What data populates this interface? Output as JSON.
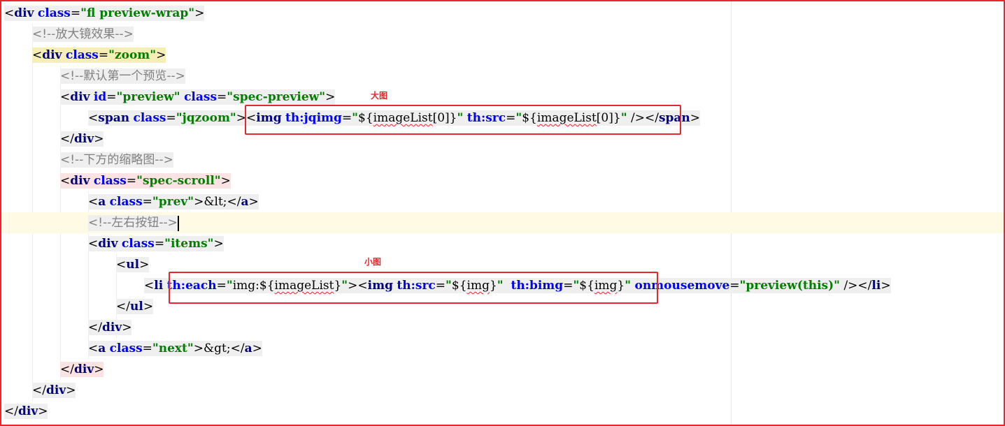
{
  "editor": {
    "lines": [
      {
        "indent": 0,
        "tokens": [
          [
            "angle",
            "<"
          ],
          [
            "tag",
            "div"
          ],
          [
            "sp",
            " "
          ],
          [
            "attr",
            "class"
          ],
          [
            "punct",
            "="
          ],
          [
            "val",
            "\"fl preview-wrap\""
          ],
          [
            "angle",
            ">"
          ]
        ]
      },
      {
        "indent": 1,
        "tokens": [
          [
            "comment",
            "<!--放大镜效果-->"
          ]
        ]
      },
      {
        "indent": 1,
        "tokens": [
          [
            "angle",
            "<"
          ],
          [
            "tag",
            "div"
          ],
          [
            "sp",
            " "
          ],
          [
            "attr",
            "class"
          ],
          [
            "punct",
            "="
          ],
          [
            "val",
            "\"zoom\""
          ],
          [
            "angle",
            ">"
          ]
        ]
      },
      {
        "indent": 2,
        "tokens": [
          [
            "comment",
            "<!--默认第一个预览-->"
          ]
        ]
      },
      {
        "indent": 2,
        "tokens": [
          [
            "angle",
            "<"
          ],
          [
            "tag",
            "div"
          ],
          [
            "sp",
            " "
          ],
          [
            "attr",
            "id"
          ],
          [
            "punct",
            "="
          ],
          [
            "val",
            "\"preview\""
          ],
          [
            "sp",
            " "
          ],
          [
            "attr",
            "class"
          ],
          [
            "punct",
            "="
          ],
          [
            "val",
            "\"spec-preview\""
          ],
          [
            "angle",
            ">"
          ]
        ]
      },
      {
        "indent": 3,
        "tokens": [
          [
            "angle",
            "<"
          ],
          [
            "tag",
            "span"
          ],
          [
            "sp",
            " "
          ],
          [
            "attr",
            "class"
          ],
          [
            "punct",
            "="
          ],
          [
            "val",
            "\"jqzoom\""
          ],
          [
            "angle",
            ">"
          ],
          [
            "angle",
            "<"
          ],
          [
            "tag",
            "img"
          ],
          [
            "sp",
            " "
          ],
          [
            "attr",
            "th:jqimg"
          ],
          [
            "punct",
            "="
          ],
          [
            "val",
            "\""
          ],
          [
            "expr",
            "${"
          ],
          [
            "squig",
            "imageList"
          ],
          [
            "expr",
            "[0]}"
          ],
          [
            "val",
            "\""
          ],
          [
            "sp",
            " "
          ],
          [
            "attr",
            "th:src"
          ],
          [
            "punct",
            "="
          ],
          [
            "val",
            "\""
          ],
          [
            "expr",
            "${"
          ],
          [
            "squig",
            "imageList"
          ],
          [
            "expr",
            "[0]}"
          ],
          [
            "val",
            "\""
          ],
          [
            "sp",
            " "
          ],
          [
            "angle",
            "/>"
          ],
          [
            "angle",
            "</"
          ],
          [
            "tag",
            "span"
          ],
          [
            "angle",
            ">"
          ]
        ]
      },
      {
        "indent": 2,
        "tokens": [
          [
            "angle",
            "</"
          ],
          [
            "tag",
            "div"
          ],
          [
            "angle",
            ">"
          ]
        ]
      },
      {
        "indent": 2,
        "tokens": [
          [
            "comment",
            "<!--下方的缩略图-->"
          ]
        ]
      },
      {
        "indent": 2,
        "tokens": [
          [
            "angle",
            "<"
          ],
          [
            "tag",
            "div"
          ],
          [
            "sp",
            " "
          ],
          [
            "attr",
            "class"
          ],
          [
            "punct",
            "="
          ],
          [
            "val",
            "\"spec-scroll\""
          ],
          [
            "angle",
            ">"
          ]
        ]
      },
      {
        "indent": 3,
        "tokens": [
          [
            "angle",
            "<"
          ],
          [
            "tag",
            "a"
          ],
          [
            "sp",
            " "
          ],
          [
            "attr",
            "class"
          ],
          [
            "punct",
            "="
          ],
          [
            "val",
            "\"prev\""
          ],
          [
            "angle",
            ">"
          ],
          [
            "entity",
            "&lt;"
          ],
          [
            "angle",
            "</"
          ],
          [
            "tag",
            "a"
          ],
          [
            "angle",
            ">"
          ]
        ]
      },
      {
        "indent": 3,
        "tokens": [
          [
            "comment",
            "<!--左右按钮-->"
          ]
        ]
      },
      {
        "indent": 3,
        "tokens": [
          [
            "angle",
            "<"
          ],
          [
            "tag",
            "div"
          ],
          [
            "sp",
            " "
          ],
          [
            "attr",
            "class"
          ],
          [
            "punct",
            "="
          ],
          [
            "val",
            "\"items\""
          ],
          [
            "angle",
            ">"
          ]
        ]
      },
      {
        "indent": 4,
        "tokens": [
          [
            "angle",
            "<"
          ],
          [
            "tag",
            "ul"
          ],
          [
            "angle",
            ">"
          ]
        ]
      },
      {
        "indent": 5,
        "tokens": [
          [
            "angle",
            "<"
          ],
          [
            "tag",
            "li"
          ],
          [
            "sp",
            " "
          ],
          [
            "attr",
            "th:each"
          ],
          [
            "punct",
            "="
          ],
          [
            "val",
            "\""
          ],
          [
            "expr",
            "img:${"
          ],
          [
            "squig",
            "imageList"
          ],
          [
            "expr",
            "}"
          ],
          [
            "val",
            "\""
          ],
          [
            "angle",
            ">"
          ],
          [
            "angle",
            "<"
          ],
          [
            "tag",
            "img"
          ],
          [
            "sp",
            " "
          ],
          [
            "attr",
            "th:src"
          ],
          [
            "punct",
            "="
          ],
          [
            "val",
            "\""
          ],
          [
            "expr",
            "${"
          ],
          [
            "squig",
            "img"
          ],
          [
            "expr",
            "}"
          ],
          [
            "val",
            "\""
          ],
          [
            "sp",
            "  "
          ],
          [
            "attr",
            "th:bimg"
          ],
          [
            "punct",
            "="
          ],
          [
            "val",
            "\""
          ],
          [
            "expr",
            "${"
          ],
          [
            "squig",
            "img"
          ],
          [
            "expr",
            "}"
          ],
          [
            "val",
            "\""
          ],
          [
            "sp",
            " "
          ],
          [
            "attr",
            "onmousemove"
          ],
          [
            "punct",
            "="
          ],
          [
            "val",
            "\"preview(this)\""
          ],
          [
            "sp",
            " "
          ],
          [
            "angle",
            "/>"
          ],
          [
            "angle",
            "</"
          ],
          [
            "tag",
            "li"
          ],
          [
            "angle",
            ">"
          ]
        ]
      },
      {
        "indent": 4,
        "tokens": [
          [
            "angle",
            "</"
          ],
          [
            "tag",
            "ul"
          ],
          [
            "angle",
            ">"
          ]
        ]
      },
      {
        "indent": 3,
        "tokens": [
          [
            "angle",
            "</"
          ],
          [
            "tag",
            "div"
          ],
          [
            "angle",
            ">"
          ]
        ]
      },
      {
        "indent": 3,
        "tokens": [
          [
            "angle",
            "<"
          ],
          [
            "tag",
            "a"
          ],
          [
            "sp",
            " "
          ],
          [
            "attr",
            "class"
          ],
          [
            "punct",
            "="
          ],
          [
            "val",
            "\"next\""
          ],
          [
            "angle",
            ">"
          ],
          [
            "entity",
            "&gt;"
          ],
          [
            "angle",
            "</"
          ],
          [
            "tag",
            "a"
          ],
          [
            "angle",
            ">"
          ]
        ]
      },
      {
        "indent": 2,
        "tokens": [
          [
            "angle",
            "</"
          ],
          [
            "tag",
            "div"
          ],
          [
            "angle",
            ">"
          ]
        ]
      },
      {
        "indent": 1,
        "tokens": [
          [
            "angle",
            "</"
          ],
          [
            "tag",
            "div"
          ],
          [
            "angle",
            ">"
          ]
        ]
      },
      {
        "indent": 0,
        "tokens": [
          [
            "angle",
            "</"
          ],
          [
            "tag",
            "div"
          ],
          [
            "angle",
            ">"
          ]
        ]
      }
    ],
    "current_line": 10
  },
  "annotations": {
    "big_image": "大图",
    "small_image": "小图"
  },
  "colors": {
    "box_red": "#e8262d",
    "tag": "#000080",
    "attribute": "#0000ff",
    "value": "#008000",
    "comment": "#808080"
  }
}
